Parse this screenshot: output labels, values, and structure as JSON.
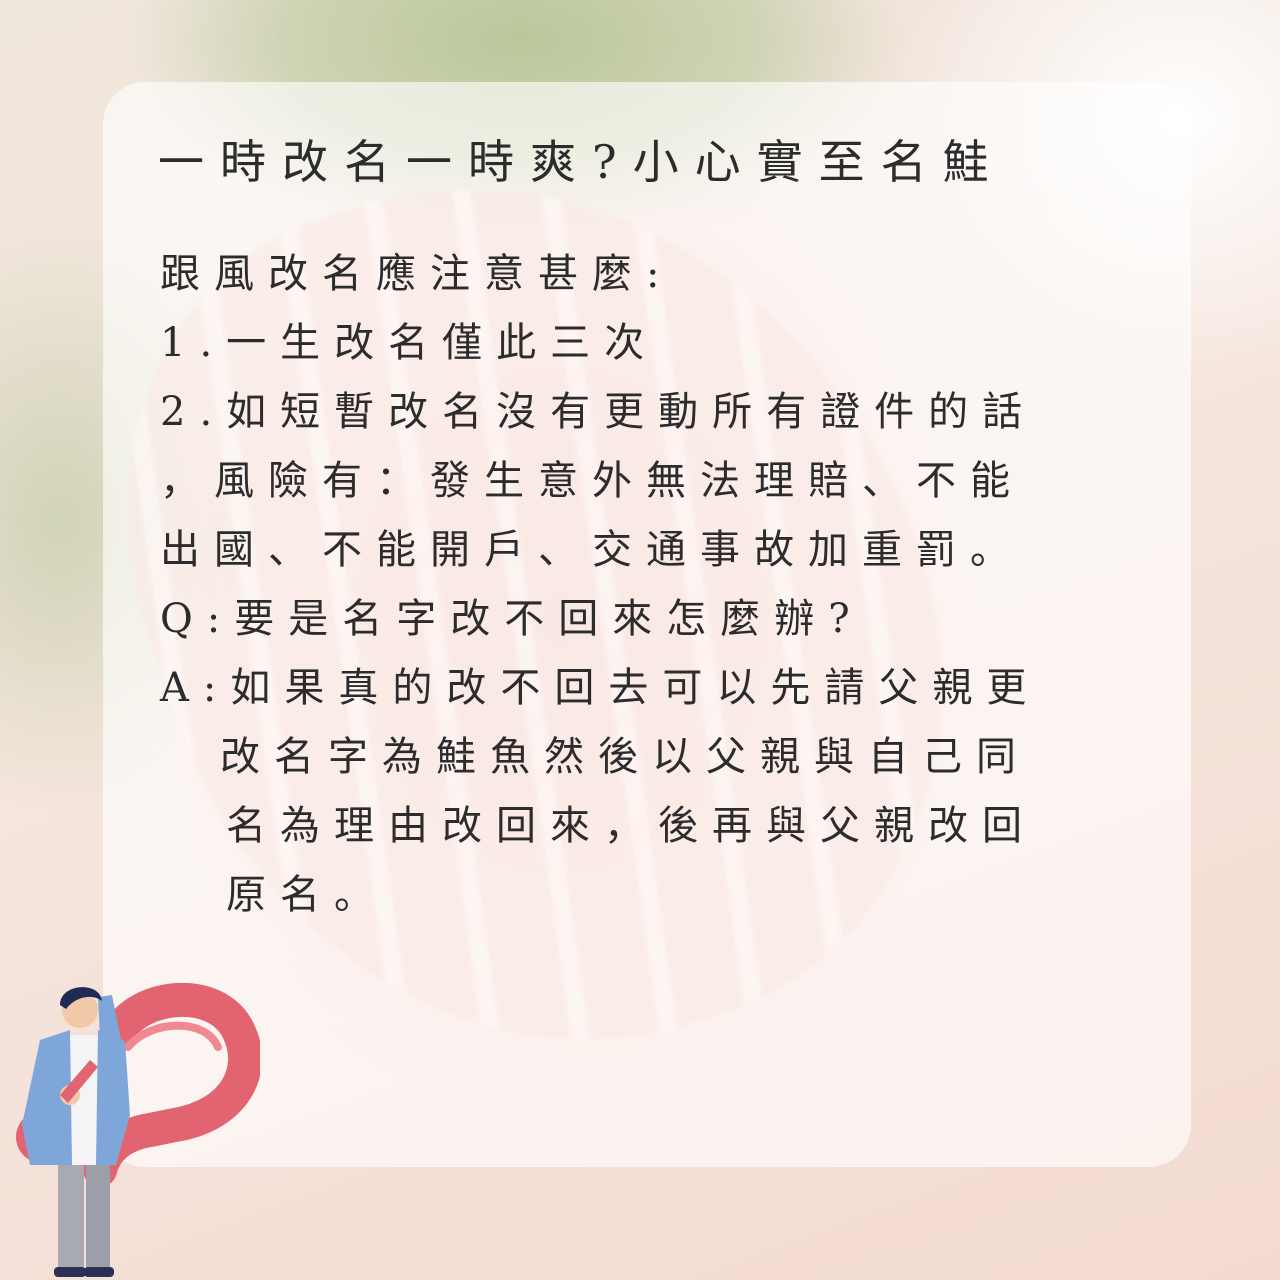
{
  "title": "一時改名一時爽?小心實至名鮭",
  "body": {
    "heading": "跟風改名應注意甚麼:",
    "point1": "1.一生改名僅此三次",
    "point2_line1": "2.如短暫改名沒有更動所有證件的話",
    "point2_line2": "，風險有：發生意外無法理賠、不能",
    "point2_line3": "出國、不能開戶、交通事故加重罰。",
    "question": "Q:要是名字改不回來怎麼辦?",
    "answer_line1": "A:如果真的改不回去可以先請父親更",
    "answer_line2": "改名字為鮭魚然後以父親與自己同",
    "answer_line3": "名為理由改回來，後再與父親改回",
    "answer_line4": "原名。"
  },
  "illustration": {
    "subject": "person-with-question-mark",
    "question_mark_color": "#e26470",
    "jacket_color": "#7fa6d9",
    "pants_color": "#a7a9b3",
    "hair_color": "#1f2a55"
  },
  "colors": {
    "text": "#2c2c2c",
    "card": "rgba(255,255,255,0.62)",
    "accent": "#e26470"
  }
}
